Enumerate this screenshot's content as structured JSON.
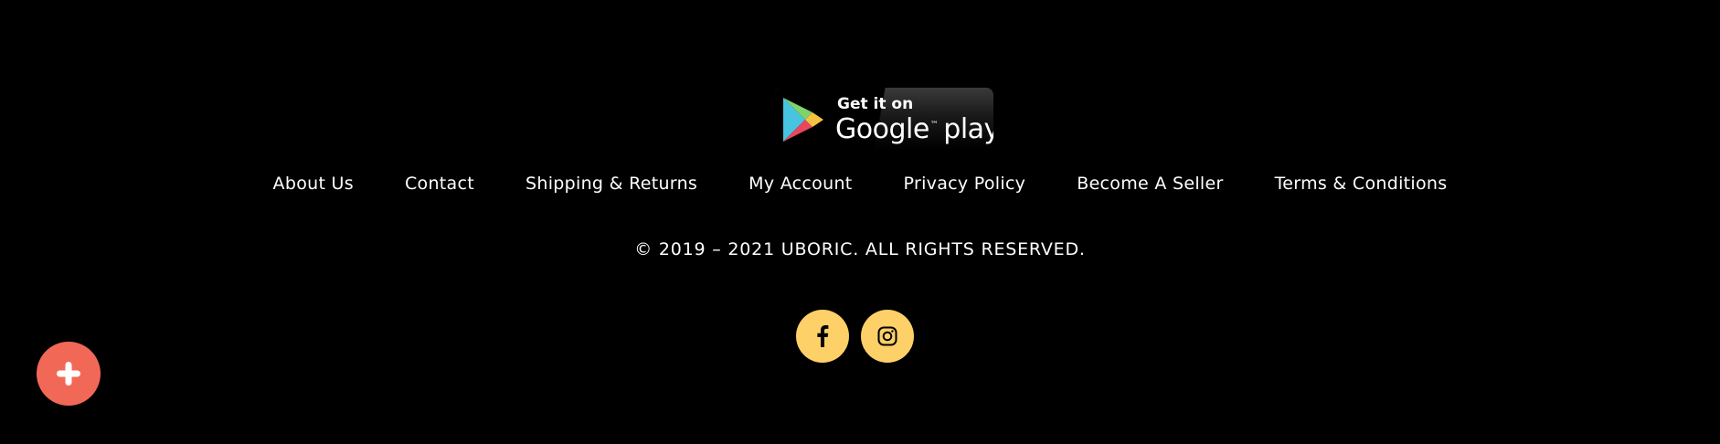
{
  "app_badge": {
    "small_text": "Get it on",
    "brand_text": "Google",
    "store_text": "play",
    "icon": "google-play-logo-icon"
  },
  "nav": {
    "links": [
      "About Us",
      "Contact",
      "Shipping & Returns",
      "My Account",
      "Privacy Policy",
      "Become A Seller",
      "Terms & Conditions"
    ]
  },
  "copyright": "© 2019 – 2021 UBORIC. ALL RIGHTS RESERVED.",
  "social": {
    "items": [
      {
        "icon": "facebook-icon"
      },
      {
        "icon": "instagram-icon"
      }
    ],
    "color": "#fdd068"
  },
  "fab": {
    "icon": "plus-icon",
    "color": "#f26857"
  },
  "colors": {
    "background": "#000000",
    "text": "#ffffff"
  }
}
